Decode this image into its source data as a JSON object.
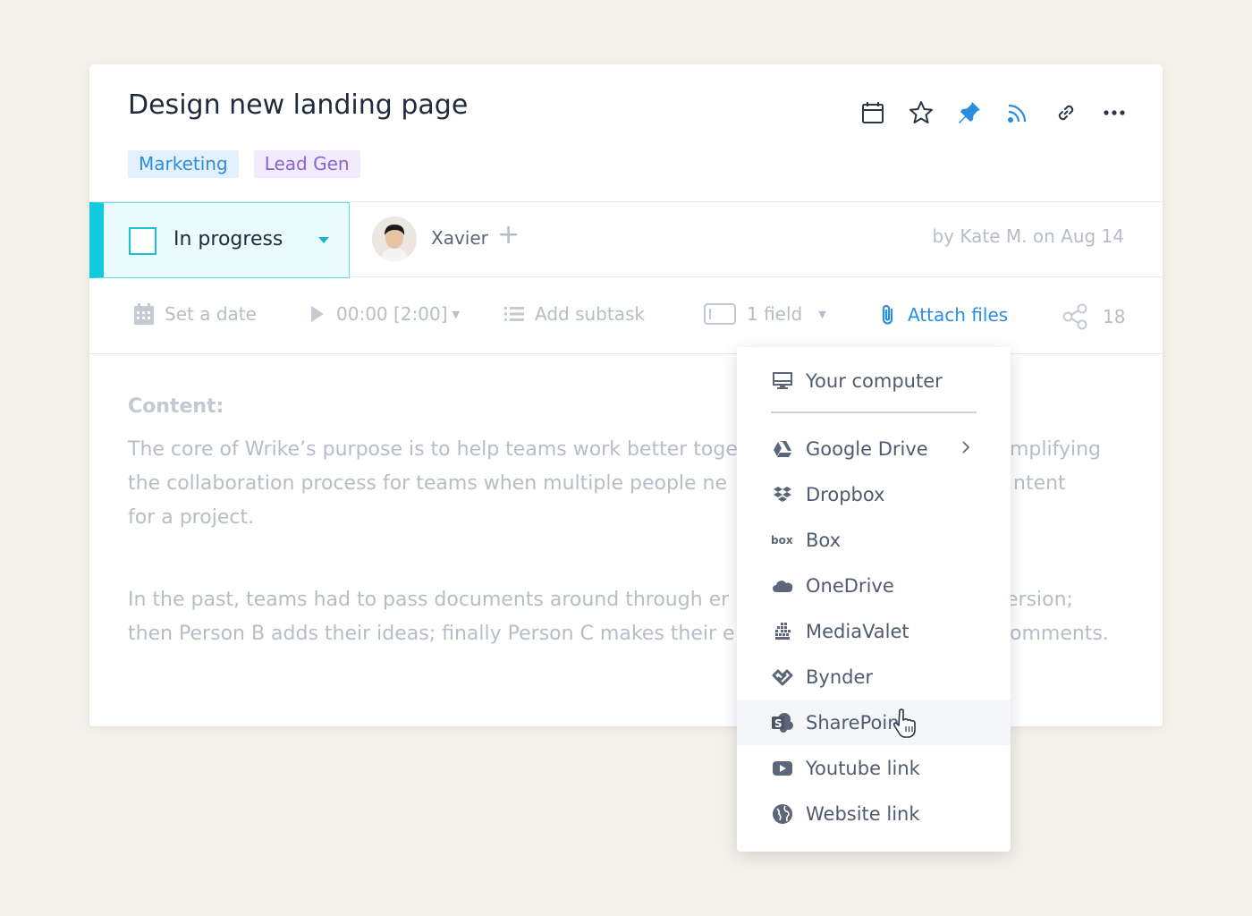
{
  "task": {
    "title": "Design new landing page",
    "tags": [
      "Marketing",
      "Lead Gen"
    ]
  },
  "header_icons": [
    "calendar-icon",
    "star-icon",
    "pin-icon",
    "rss-icon",
    "link-icon",
    "more-icon"
  ],
  "status": {
    "label": "In progress",
    "color": "#10cbdc"
  },
  "assignee": {
    "name": "Xavier"
  },
  "byline": "by Kate M. on Aug 14",
  "toolbar": {
    "date": "Set a date",
    "timer": "00:00 [2:00]",
    "subtask": "Add subtask",
    "field": "1 field",
    "attach": "Attach files",
    "shares": "18"
  },
  "content": {
    "label": "Content:",
    "paragraph1_left": "The core of Wrike’s purpose is to help teams work better toge",
    "paragraph1_right": "mplifying",
    "paragraph1_line2_left": "the collaboration process for teams when multiple people ne",
    "paragraph1_line2_right": "ntent",
    "paragraph1_line3": "for a project.",
    "paragraph2_left": "In the past, teams had to pass documents around through er",
    "paragraph2_right": "ersion;",
    "paragraph2_line2_left": "then Person B adds their ideas; finally Person C makes their e",
    "paragraph2_line2_right": "omments."
  },
  "attach_menu": {
    "items": [
      {
        "label": "Your computer",
        "icon": "computer-icon"
      },
      {
        "label": "Google Drive",
        "icon": "google-drive-icon"
      },
      {
        "label": "Dropbox",
        "icon": "dropbox-icon"
      },
      {
        "label": "Box",
        "icon": "box-icon"
      },
      {
        "label": "OneDrive",
        "icon": "onedrive-icon"
      },
      {
        "label": "MediaValet",
        "icon": "mediavalet-icon"
      },
      {
        "label": "Bynder",
        "icon": "bynder-icon"
      },
      {
        "label": "SharePoint",
        "icon": "sharepoint-icon"
      },
      {
        "label": "Youtube link",
        "icon": "youtube-icon"
      },
      {
        "label": "Website link",
        "icon": "globe-icon"
      }
    ],
    "hovered": "SharePoint"
  },
  "colors": {
    "accent_blue": "#2b8de0",
    "status_cyan": "#10cbdc",
    "background": "#f4f1ea"
  }
}
